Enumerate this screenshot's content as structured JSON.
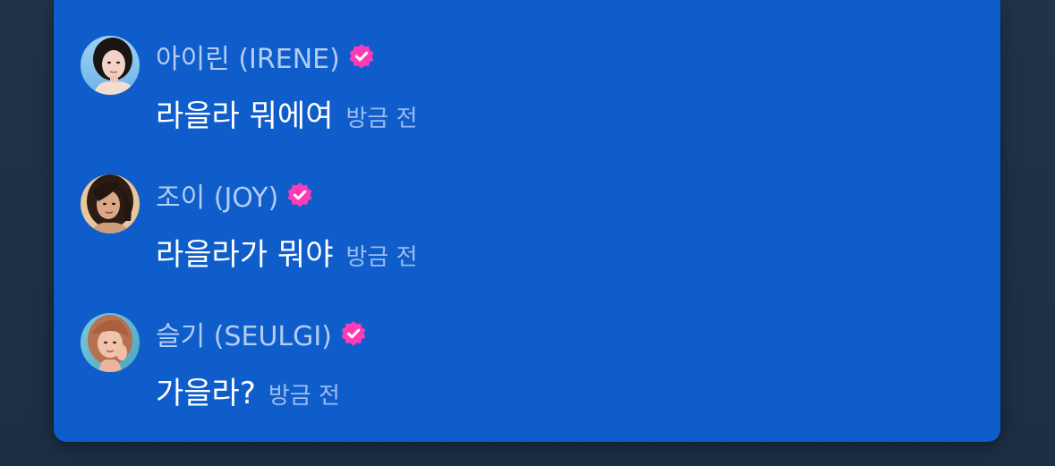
{
  "colors": {
    "background": "#1f3347",
    "panel": "#0e5dcb",
    "name_text": "#b3ccf2",
    "message_text": "#ffffff",
    "time_text": "#9dbcef",
    "verified_badge": "#ff3ab6"
  },
  "messages": [
    {
      "author": "아이린 (IRENE)",
      "verified_icon": "verified-badge-icon",
      "text": "라을라 뭐에여",
      "time": "방금 전"
    },
    {
      "author": "조이 (JOY)",
      "verified_icon": "verified-badge-icon",
      "text": "라을라가 뭐야",
      "time": "방금 전"
    },
    {
      "author": "슬기 (SEULGI)",
      "verified_icon": "verified-badge-icon",
      "text": "가을라?",
      "time": "방금 전"
    }
  ]
}
